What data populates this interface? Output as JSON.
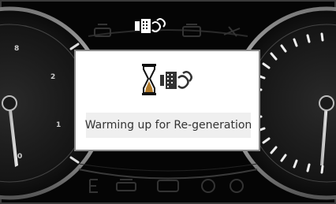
{
  "popup": {
    "message": "Warming up for Re-generation",
    "icon": "dpf-regeneration-hourglass-icon"
  },
  "indicators": {
    "top_active": "dpf-warning-icon",
    "top_inactive": [
      "cruise-icon",
      "engine-icon",
      "steering-icon"
    ],
    "bottom": [
      "fuel-e-icon",
      "traction-icon",
      "engine-check-icon",
      "gear-icon",
      "power-icon"
    ]
  },
  "gauges": {
    "left": {
      "name": "temperature/tachometer",
      "visible_labels": [
        "8",
        "2",
        "1",
        "0"
      ]
    },
    "right": {
      "name": "speedometer"
    }
  },
  "colors": {
    "background": "#000000",
    "popup_bg": "#ffffff",
    "message_bg": "#efefef",
    "active_icon": "#ffffff",
    "inactive_icon": "#3a3a3a"
  }
}
